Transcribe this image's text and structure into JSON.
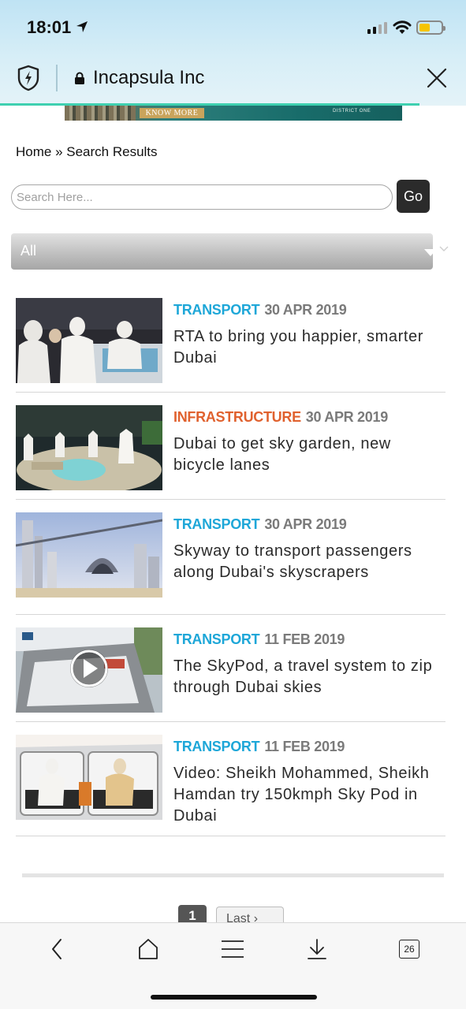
{
  "status_bar": {
    "time": "18:01"
  },
  "browser": {
    "site_name": "Incapsula Inc",
    "tabs_count": "26"
  },
  "banner": {
    "button": "KNOW MORE",
    "brand": "DISTRICT ONE"
  },
  "breadcrumb": "Home » Search Results",
  "search": {
    "placeholder": "Search Here...",
    "go_label": "Go"
  },
  "filter": {
    "selected": "All"
  },
  "colors": {
    "transport": "#1ea7d8",
    "infrastructure": "#e0612e",
    "date": "#7a7a7a"
  },
  "articles": [
    {
      "category": "TRANSPORT",
      "date": "30 APR 2019",
      "title": "RTA to bring you happier, smarter Dubai"
    },
    {
      "category": "INFRASTRUCTURE",
      "date": "30 APR 2019",
      "title": "Dubai to get sky garden, new bicycle lanes"
    },
    {
      "category": "TRANSPORT",
      "date": "30 APR 2019",
      "title": "Skyway to transport passengers along Dubai's skyscrapers"
    },
    {
      "category": "TRANSPORT",
      "date": "11 FEB 2019",
      "title": "The SkyPod, a travel system to zip through Dubai skies"
    },
    {
      "category": "TRANSPORT",
      "date": "11 FEB 2019",
      "title": "Video: Sheikh Mohammed, Sheikh Hamdan try 150kmph Sky Pod in Dubai"
    }
  ],
  "pagination": {
    "current": "1",
    "last": "Last ›"
  }
}
